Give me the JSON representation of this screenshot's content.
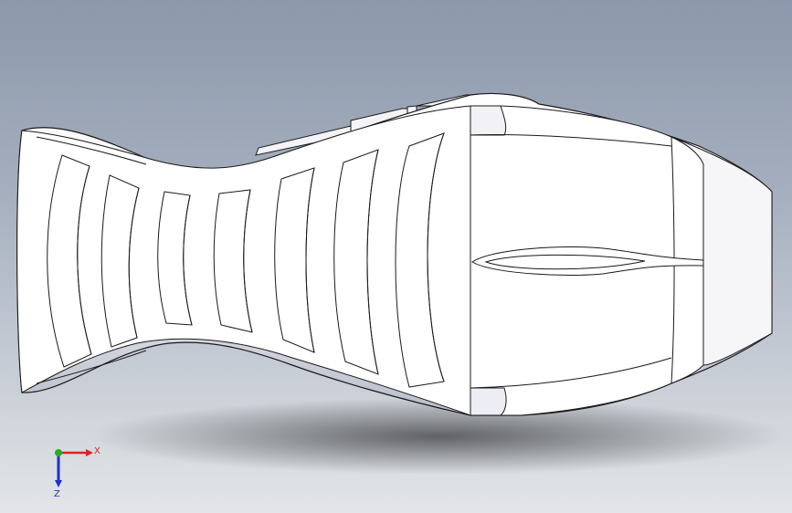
{
  "viewport": {
    "background_top": "#8c98ab",
    "background_bottom": "#e3e5e8",
    "model_fill": "#ffffff",
    "edge_color": "#1a1a1a"
  },
  "triad": {
    "x_label": "X",
    "z_label": "Z",
    "x_color": "#e02020",
    "y_color": "#20b020",
    "z_color": "#2030d0"
  }
}
